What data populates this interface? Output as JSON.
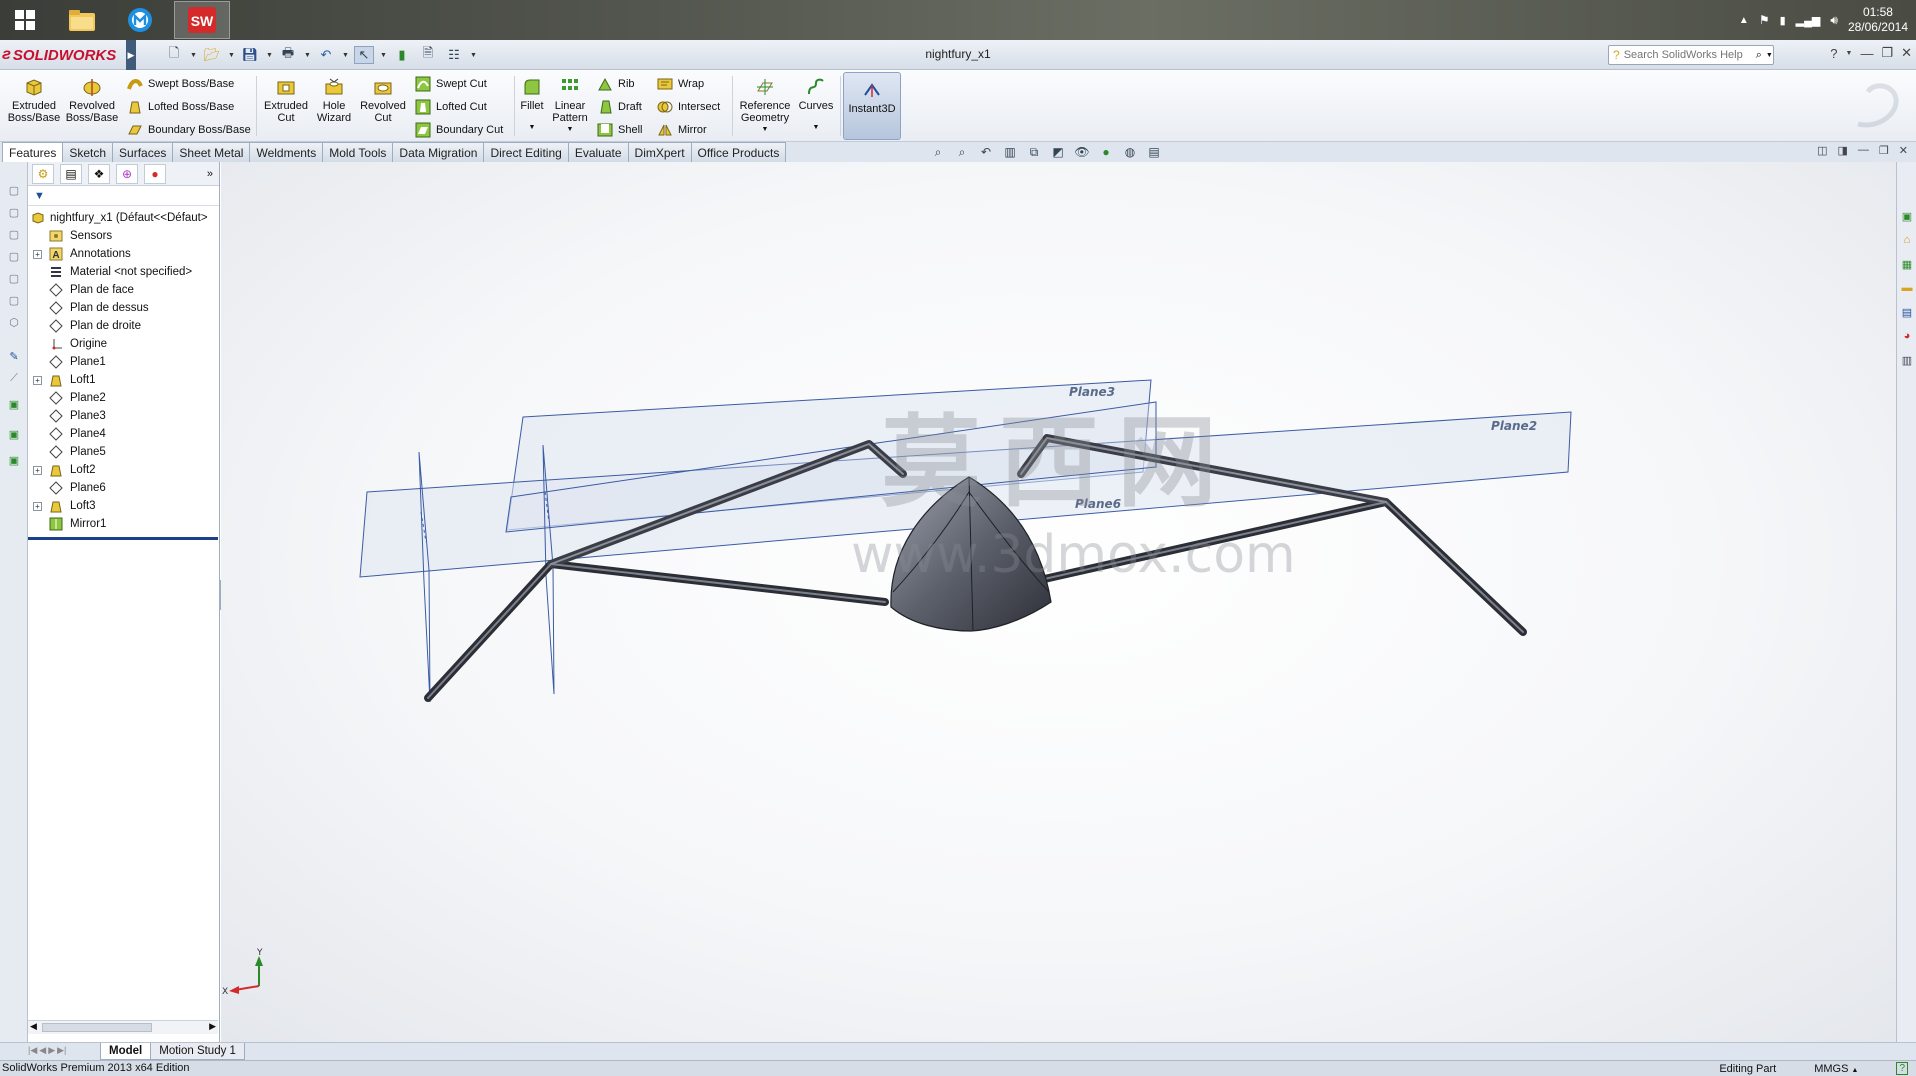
{
  "taskbar": {
    "apps": [
      {
        "name": "windows-explorer",
        "icon": "folder-icon"
      },
      {
        "name": "maxthon",
        "icon": "maxthon-icon"
      },
      {
        "name": "solidworks",
        "icon": "solidworks-icon",
        "label": "SW"
      }
    ],
    "clock_time": "01:58",
    "clock_date": "28/06/2014"
  },
  "titlebar": {
    "logo_text": "SOLIDWORKS",
    "doc_title": "nightfury_x1",
    "search_placeholder": "Search SolidWorks Help"
  },
  "ribbon": {
    "big_buttons": [
      {
        "id": "extruded-boss",
        "label": "Extruded Boss/Base"
      },
      {
        "id": "revolved-boss",
        "label": "Revolved Boss/Base"
      },
      {
        "id": "extruded-cut",
        "label": "Extruded Cut"
      },
      {
        "id": "hole-wizard",
        "label": "Hole Wizard"
      },
      {
        "id": "revolved-cut",
        "label": "Revolved Cut"
      },
      {
        "id": "fillet",
        "label": "Fillet"
      },
      {
        "id": "linear-pattern",
        "label": "Linear Pattern"
      },
      {
        "id": "reference-geometry",
        "label": "Reference Geometry"
      },
      {
        "id": "curves",
        "label": "Curves"
      },
      {
        "id": "instant3d",
        "label": "Instant3D"
      }
    ],
    "small_buttons": {
      "swept_boss": "Swept Boss/Base",
      "lofted_boss": "Lofted Boss/Base",
      "boundary_boss": "Boundary Boss/Base",
      "swept_cut": "Swept Cut",
      "lofted_cut": "Lofted Cut",
      "boundary_cut": "Boundary Cut",
      "rib": "Rib",
      "draft": "Draft",
      "shell": "Shell",
      "wrap": "Wrap",
      "intersect": "Intersect",
      "mirror": "Mirror"
    }
  },
  "tabs": [
    "Features",
    "Sketch",
    "Surfaces",
    "Sheet Metal",
    "Weldments",
    "Mold Tools",
    "Data Migration",
    "Direct Editing",
    "Evaluate",
    "DimXpert",
    "Office Products"
  ],
  "active_tab": "Features",
  "feature_tree": {
    "root": "nightfury_x1  (Défaut<<Défaut>",
    "items": [
      {
        "label": "Sensors",
        "icon": "sensor-icon",
        "expandable": false
      },
      {
        "label": "Annotations",
        "icon": "annotation-icon",
        "expandable": true
      },
      {
        "label": "Material <not specified>",
        "icon": "material-icon",
        "expandable": false
      },
      {
        "label": "Plan de face",
        "icon": "plane-icon",
        "expandable": false
      },
      {
        "label": "Plan de dessus",
        "icon": "plane-icon",
        "expandable": false
      },
      {
        "label": "Plan de droite",
        "icon": "plane-icon",
        "expandable": false
      },
      {
        "label": "Origine",
        "icon": "origin-icon",
        "expandable": false
      },
      {
        "label": "Plane1",
        "icon": "plane-icon",
        "expandable": false
      },
      {
        "label": "Loft1",
        "icon": "loft-icon",
        "expandable": true
      },
      {
        "label": "Plane2",
        "icon": "plane-icon",
        "expandable": false
      },
      {
        "label": "Plane3",
        "icon": "plane-icon",
        "expandable": false
      },
      {
        "label": "Plane4",
        "icon": "plane-icon",
        "expandable": false
      },
      {
        "label": "Plane5",
        "icon": "plane-icon",
        "expandable": false
      },
      {
        "label": "Loft2",
        "icon": "loft-icon",
        "expandable": true
      },
      {
        "label": "Plane6",
        "icon": "plane-icon",
        "expandable": false
      },
      {
        "label": "Loft3",
        "icon": "loft-icon",
        "expandable": true
      },
      {
        "label": "Mirror1",
        "icon": "mirror-icon",
        "expandable": false
      }
    ]
  },
  "viewport": {
    "plane_labels": [
      "Plane3",
      "Plane2",
      "Plane6"
    ],
    "watermark_cn": "莫西网",
    "watermark_url": "www.3dmox.com",
    "triad_x": "X",
    "triad_y": "Y"
  },
  "model_tabs": [
    "Model",
    "Motion Study 1"
  ],
  "active_model_tab": "Model",
  "status": {
    "edition": "SolidWorks Premium 2013 x64 Edition",
    "mode": "Editing Part",
    "units": "MMGS"
  },
  "colors": {
    "accent_red": "#c8102e",
    "ribbon_bg": "#eef2f7",
    "plane_line": "#3b5ba5",
    "body_fill": "#5a5e68"
  }
}
